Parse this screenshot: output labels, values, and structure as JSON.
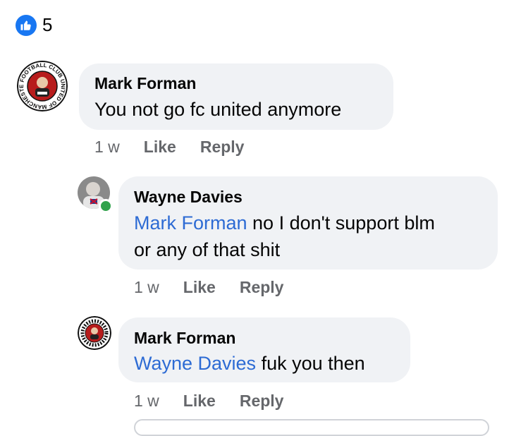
{
  "reactions": {
    "icon": "thumbs-up-icon",
    "count": "5",
    "color": "#1877f2"
  },
  "comments": [
    {
      "author": "Mark Forman",
      "text": "You not go fc united anymore",
      "time": "1 w",
      "like_label": "Like",
      "reply_label": "Reply",
      "avatar_icon": "fc-united-crest-avatar",
      "avatar_ring_text": "FOOTBALL CLUB UNITED OF MANCHESTER"
    },
    {
      "author": "Wayne Davies",
      "mention": "Mark Forman",
      "line1": " no I don't support blm",
      "line2": "or any of that shit",
      "time": "1 w",
      "like_label": "Like",
      "reply_label": "Reply",
      "avatar_icon": "profile-photo-avatar",
      "online": true
    },
    {
      "author": "Mark Forman",
      "mention": "Wayne Davies",
      "text": " fuk you then",
      "time": "1 w",
      "like_label": "Like",
      "reply_label": "Reply",
      "avatar_icon": "fc-united-crest-avatar"
    }
  ],
  "colors": {
    "bubble": "#f0f2f5",
    "mention": "#2d6bd4",
    "meta": "#65676b",
    "online": "#31a24c"
  }
}
